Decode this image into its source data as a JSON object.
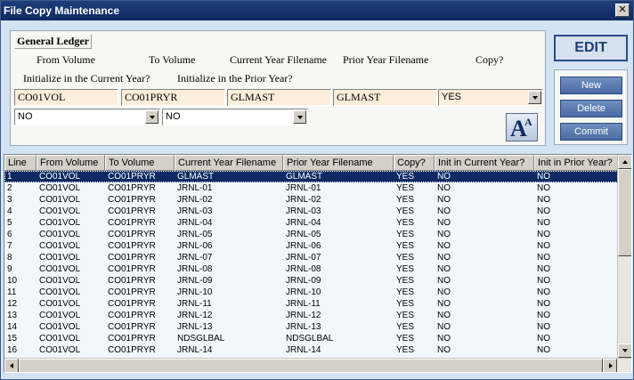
{
  "window": {
    "title": "File Copy Maintenance",
    "close_glyph": "✕"
  },
  "group": {
    "title": "General Ledger"
  },
  "labels": {
    "from_volume": "From Volume",
    "to_volume": "To Volume",
    "current_year_filename": "Current Year Filename",
    "prior_year_filename": "Prior Year Filename",
    "copy": "Copy?",
    "init_current": "Initialize in the Current Year?",
    "init_prior": "Initialize in the Prior Year?"
  },
  "fields": {
    "from_volume": "CO01VOL",
    "to_volume": "CO01PRYR",
    "current_year_filename": "GLMAST",
    "prior_year_filename": "GLMAST",
    "copy": "YES",
    "init_current": "NO",
    "init_prior": "NO"
  },
  "mode": "EDIT",
  "buttons": {
    "new": "New",
    "delete": "Delete",
    "commit": "Commit"
  },
  "font_button": {
    "big": "A",
    "small": "A"
  },
  "table": {
    "columns": [
      "Line",
      "From Volume",
      "To Volume",
      "Current Year Filename",
      "Prior Year Filename",
      "Copy?",
      "Init in Current Year?",
      "Init in Prior Year?"
    ],
    "rows": [
      [
        "1",
        "CO01VOL",
        "CO01PRYR",
        "GLMAST",
        "GLMAST",
        "YES",
        "NO",
        "NO"
      ],
      [
        "2",
        "CO01VOL",
        "CO01PRYR",
        "JRNL-01",
        "JRNL-01",
        "YES",
        "NO",
        "NO"
      ],
      [
        "3",
        "CO01VOL",
        "CO01PRYR",
        "JRNL-02",
        "JRNL-02",
        "YES",
        "NO",
        "NO"
      ],
      [
        "4",
        "CO01VOL",
        "CO01PRYR",
        "JRNL-03",
        "JRNL-03",
        "YES",
        "NO",
        "NO"
      ],
      [
        "5",
        "CO01VOL",
        "CO01PRYR",
        "JRNL-04",
        "JRNL-04",
        "YES",
        "NO",
        "NO"
      ],
      [
        "6",
        "CO01VOL",
        "CO01PRYR",
        "JRNL-05",
        "JRNL-05",
        "YES",
        "NO",
        "NO"
      ],
      [
        "7",
        "CO01VOL",
        "CO01PRYR",
        "JRNL-06",
        "JRNL-06",
        "YES",
        "NO",
        "NO"
      ],
      [
        "8",
        "CO01VOL",
        "CO01PRYR",
        "JRNL-07",
        "JRNL-07",
        "YES",
        "NO",
        "NO"
      ],
      [
        "9",
        "CO01VOL",
        "CO01PRYR",
        "JRNL-08",
        "JRNL-08",
        "YES",
        "NO",
        "NO"
      ],
      [
        "10",
        "CO01VOL",
        "CO01PRYR",
        "JRNL-09",
        "JRNL-09",
        "YES",
        "NO",
        "NO"
      ],
      [
        "11",
        "CO01VOL",
        "CO01PRYR",
        "JRNL-10",
        "JRNL-10",
        "YES",
        "NO",
        "NO"
      ],
      [
        "12",
        "CO01VOL",
        "CO01PRYR",
        "JRNL-11",
        "JRNL-11",
        "YES",
        "NO",
        "NO"
      ],
      [
        "13",
        "CO01VOL",
        "CO01PRYR",
        "JRNL-12",
        "JRNL-12",
        "YES",
        "NO",
        "NO"
      ],
      [
        "14",
        "CO01VOL",
        "CO01PRYR",
        "JRNL-13",
        "JRNL-13",
        "YES",
        "NO",
        "NO"
      ],
      [
        "15",
        "CO01VOL",
        "CO01PRYR",
        "NDSGLBAL",
        "NDSGLBAL",
        "YES",
        "NO",
        "NO"
      ],
      [
        "16",
        "CO01VOL",
        "CO01PRYR",
        "JRNL-14",
        "JRNL-14",
        "YES",
        "NO",
        "NO"
      ]
    ],
    "selected_row": 0
  },
  "colors": {
    "title_bar": "#0e2a63",
    "field_bg": "#fbeedb",
    "selected_row": "#0e2a63",
    "button": "#4a6aa3"
  }
}
